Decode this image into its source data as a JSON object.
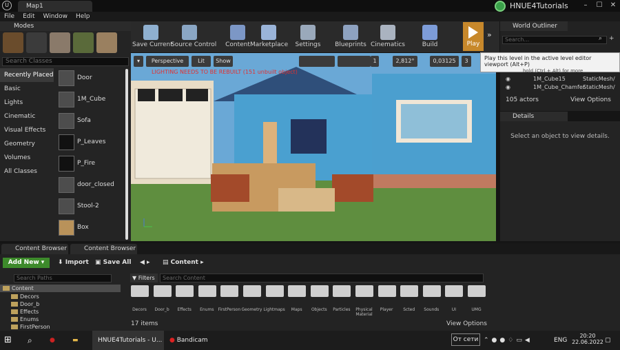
{
  "title_bar": {
    "tab": "Map1",
    "project": "HNUE4Tutorials"
  },
  "menu": [
    "File",
    "Edit",
    "Window",
    "Help"
  ],
  "modes": {
    "title": "Modes",
    "search_placeholder": "Search Classes",
    "categories": [
      "Recently Placed",
      "Basic",
      "Lights",
      "Cinematic",
      "Visual Effects",
      "Geometry",
      "Volumes",
      "All Classes"
    ],
    "items": [
      "Door",
      "1M_Cube",
      "Sofa",
      "P_Leaves",
      "P_Fire",
      "door_closed",
      "Stool-2",
      "Box"
    ]
  },
  "toolbar": [
    "Save Current",
    "Source Control",
    "Content",
    "Marketplace",
    "Settings",
    "Blueprints",
    "Cinematics",
    "Build",
    "Play"
  ],
  "viewport": {
    "perspective": "Perspective",
    "lit": "Lit",
    "show": "Show",
    "warning": "LIGHTING NEEDS TO BE REBUILT (151 unbuilt object)",
    "grid": "1",
    "rotation": "2,812°",
    "scale": "0,03125",
    "cam": "3"
  },
  "tooltip": {
    "main": "Play this level in the active level editor viewport (Alt+P)",
    "hint": "hold (Ctrl + Alt) for more"
  },
  "outliner": {
    "title": "World Outliner",
    "search_placeholder": "Search...",
    "col_label": "Label",
    "col_type": "Type",
    "rows": [
      {
        "label": "1M_Cube15",
        "type": "StaticMesh/"
      },
      {
        "label": "1M_Cube_Chamfer",
        "type": "StaticMesh/"
      }
    ],
    "actors": "105 actors",
    "view_options": "View Options"
  },
  "details": {
    "title": "Details",
    "message": "Select an object to view details."
  },
  "content_browser": {
    "tabs": [
      "Content Browser 1",
      "Content Browser 2"
    ],
    "add_new": "Add New",
    "import": "Import",
    "save_all": "Save All",
    "path": "Content",
    "search_paths": "Search Paths",
    "search_content": "Search Content",
    "filters": "Filters",
    "tree": [
      "Content",
      "Decors",
      "Door_b",
      "Effects",
      "Enums",
      "FirstPerson"
    ],
    "folders": [
      "Decors",
      "Door_b",
      "Effects",
      "Enums",
      "FirstPerson",
      "Geometry",
      "Lightmaps",
      "Maps",
      "Objects",
      "Particles",
      "Physical Material",
      "Player",
      "Scted",
      "Sounds",
      "UI",
      "UMG"
    ],
    "count": "17 items",
    "view_options": "View Options"
  },
  "taskbar": {
    "ue_task": "HNUE4Tutorials - U...",
    "bandicam": "Bandicam",
    "network": "От сети",
    "lang": "ENG",
    "time": "20:20",
    "date": "22.06.2022"
  }
}
